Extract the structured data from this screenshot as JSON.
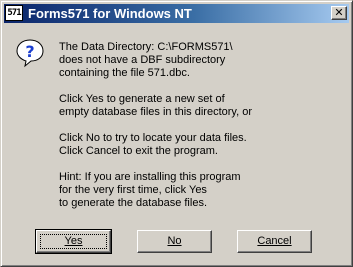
{
  "window": {
    "title": "Forms571 for Windows NT",
    "app_icon_text": "571",
    "close_glyph": "✕"
  },
  "icon": {
    "name": "question-icon",
    "glyph": "?"
  },
  "message": {
    "paragraphs": [
      "The Data Directory: C:\\FORMS571\\\ndoes not have a DBF subdirectory\ncontaining the file 571.dbc.",
      "Click Yes to generate a new set of\nempty database files in this directory, or",
      "Click No to try to locate your data files.\nClick Cancel to exit the program.",
      "Hint: If you are installing this program\nfor the very first time, click Yes\nto generate the database files."
    ]
  },
  "buttons": {
    "yes": "Yes",
    "no": "No",
    "cancel": "Cancel"
  },
  "colors": {
    "title_gradient_start": "#0a246a",
    "title_gradient_end": "#a6caf0",
    "face": "#d4d0c8",
    "question_icon": "#1c3fd0"
  }
}
